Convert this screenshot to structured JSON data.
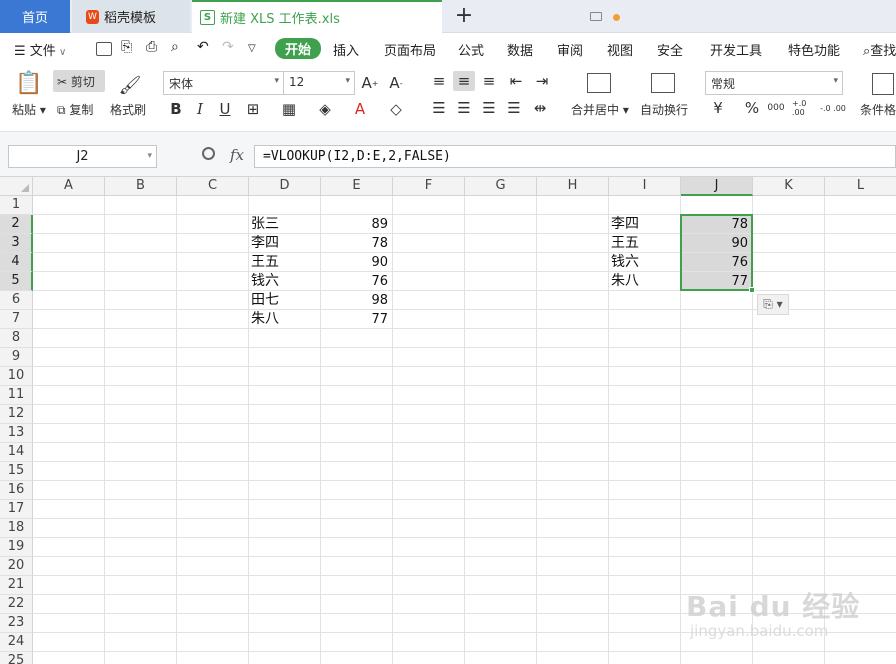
{
  "tabs": {
    "home": "首页",
    "template": "稻壳模板",
    "file": "新建 XLS 工作表.xls",
    "new_tab": "+"
  },
  "menu": {
    "file": "文件",
    "items": [
      "开始",
      "插入",
      "页面布局",
      "公式",
      "数据",
      "审阅",
      "视图",
      "安全",
      "开发工具",
      "特色功能",
      "查找"
    ],
    "active": "开始"
  },
  "ribbon": {
    "paste": "粘贴",
    "cut": "剪切",
    "copy": "复制",
    "format_painter": "格式刷",
    "font_name": "宋体",
    "font_size": "12",
    "merge_center": "合并居中",
    "wrap_text": "自动换行",
    "number_format": "常规",
    "conditional_format": "条件格",
    "percent": "%",
    "thousands": "000",
    "inc_decimal": "+.0 .00",
    "dec_decimal": "-.0 .00"
  },
  "formula_bar": {
    "name_box": "J2",
    "fx": "fx",
    "formula": "=VLOOKUP(I2,D:E,2,FALSE)"
  },
  "sheet": {
    "columns": [
      "A",
      "B",
      "C",
      "D",
      "E",
      "F",
      "G",
      "H",
      "I",
      "J",
      "K",
      "L"
    ],
    "rows": [
      "1",
      "2",
      "3",
      "4",
      "5",
      "6",
      "7",
      "8",
      "9",
      "10",
      "11",
      "12",
      "13",
      "14",
      "15",
      "16",
      "17",
      "18",
      "19",
      "20",
      "21",
      "22",
      "23",
      "24",
      "25"
    ],
    "d_names": [
      "张三",
      "李四",
      "王五",
      "钱六",
      "田七",
      "朱八"
    ],
    "e_scores": [
      "89",
      "78",
      "90",
      "76",
      "98",
      "77"
    ],
    "i_names": [
      "李四",
      "王五",
      "钱六",
      "朱八"
    ],
    "j_results": [
      "78",
      "90",
      "76",
      "77"
    ],
    "selected_cell": "J2",
    "selected_range": "J2:J5"
  },
  "watermark": {
    "brand": "Bai du 经验",
    "url": "jingyan.baidu.com"
  },
  "colors": {
    "accent_green": "#3fa14d",
    "home_tab_blue": "#3b78d4",
    "selection_gray": "#d9d9d9"
  }
}
